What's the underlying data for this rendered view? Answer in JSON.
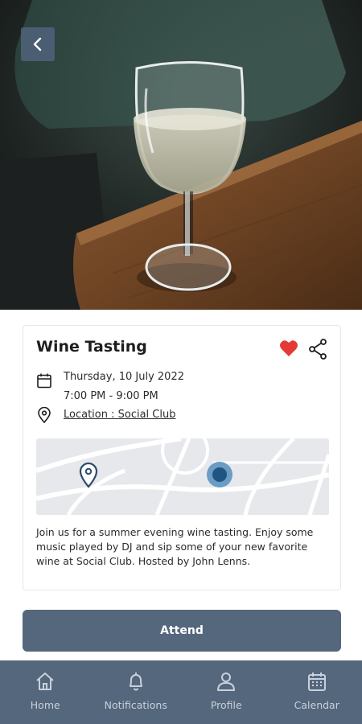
{
  "event": {
    "title": "Wine Tasting",
    "date": "Thursday, 10 July 2022",
    "time": "7:00 PM - 9:00 PM",
    "location": "Location : Social Club",
    "description": "Join us for a summer evening wine tasting. Enjoy some music played by DJ and sip some of your new favorite wine at Social Club. Hosted by John Lenns."
  },
  "actions": {
    "attend_label": "Attend"
  },
  "nav": {
    "items": [
      {
        "label": "Home",
        "icon": "home-icon"
      },
      {
        "label": "Notifications",
        "icon": "bell-icon"
      },
      {
        "label": "Profile",
        "icon": "user-icon"
      },
      {
        "label": "Calendar",
        "icon": "calendar-icon"
      }
    ]
  },
  "colors": {
    "accent": "#54677d",
    "heart": "#e53935",
    "map_marker": "#2f4b6e",
    "map_dot": "#1f5580"
  }
}
